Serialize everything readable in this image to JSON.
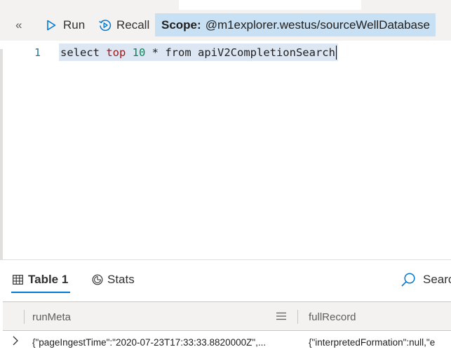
{
  "toolbar": {
    "collapse_glyph": "«",
    "run_label": "Run",
    "recall_label": "Recall",
    "scope_label": "Scope:",
    "scope_value": "@m1explorer.westus/sourceWellDatabase"
  },
  "editor": {
    "line_number": "1",
    "tokens": {
      "t1": "select ",
      "t2": "top",
      "t3": " ",
      "t4": "10",
      "t5": " * from apiV2CompletionSearch"
    }
  },
  "results": {
    "tabs": {
      "table": "Table 1",
      "stats": "Stats"
    },
    "search_label": "Search",
    "columns": [
      "runMeta",
      "fullRecord"
    ],
    "rows": [
      {
        "runMeta": "{\"pageIngestTime\":\"2020-07-23T17:33:33.8820000Z\",...",
        "fullRecord": "{\"interpretedFormation\":null,\"e"
      }
    ]
  },
  "colors": {
    "accent": "#0078d4",
    "scope_bg": "#c7e0f4",
    "keyword": "#a31515",
    "number": "#098658"
  }
}
